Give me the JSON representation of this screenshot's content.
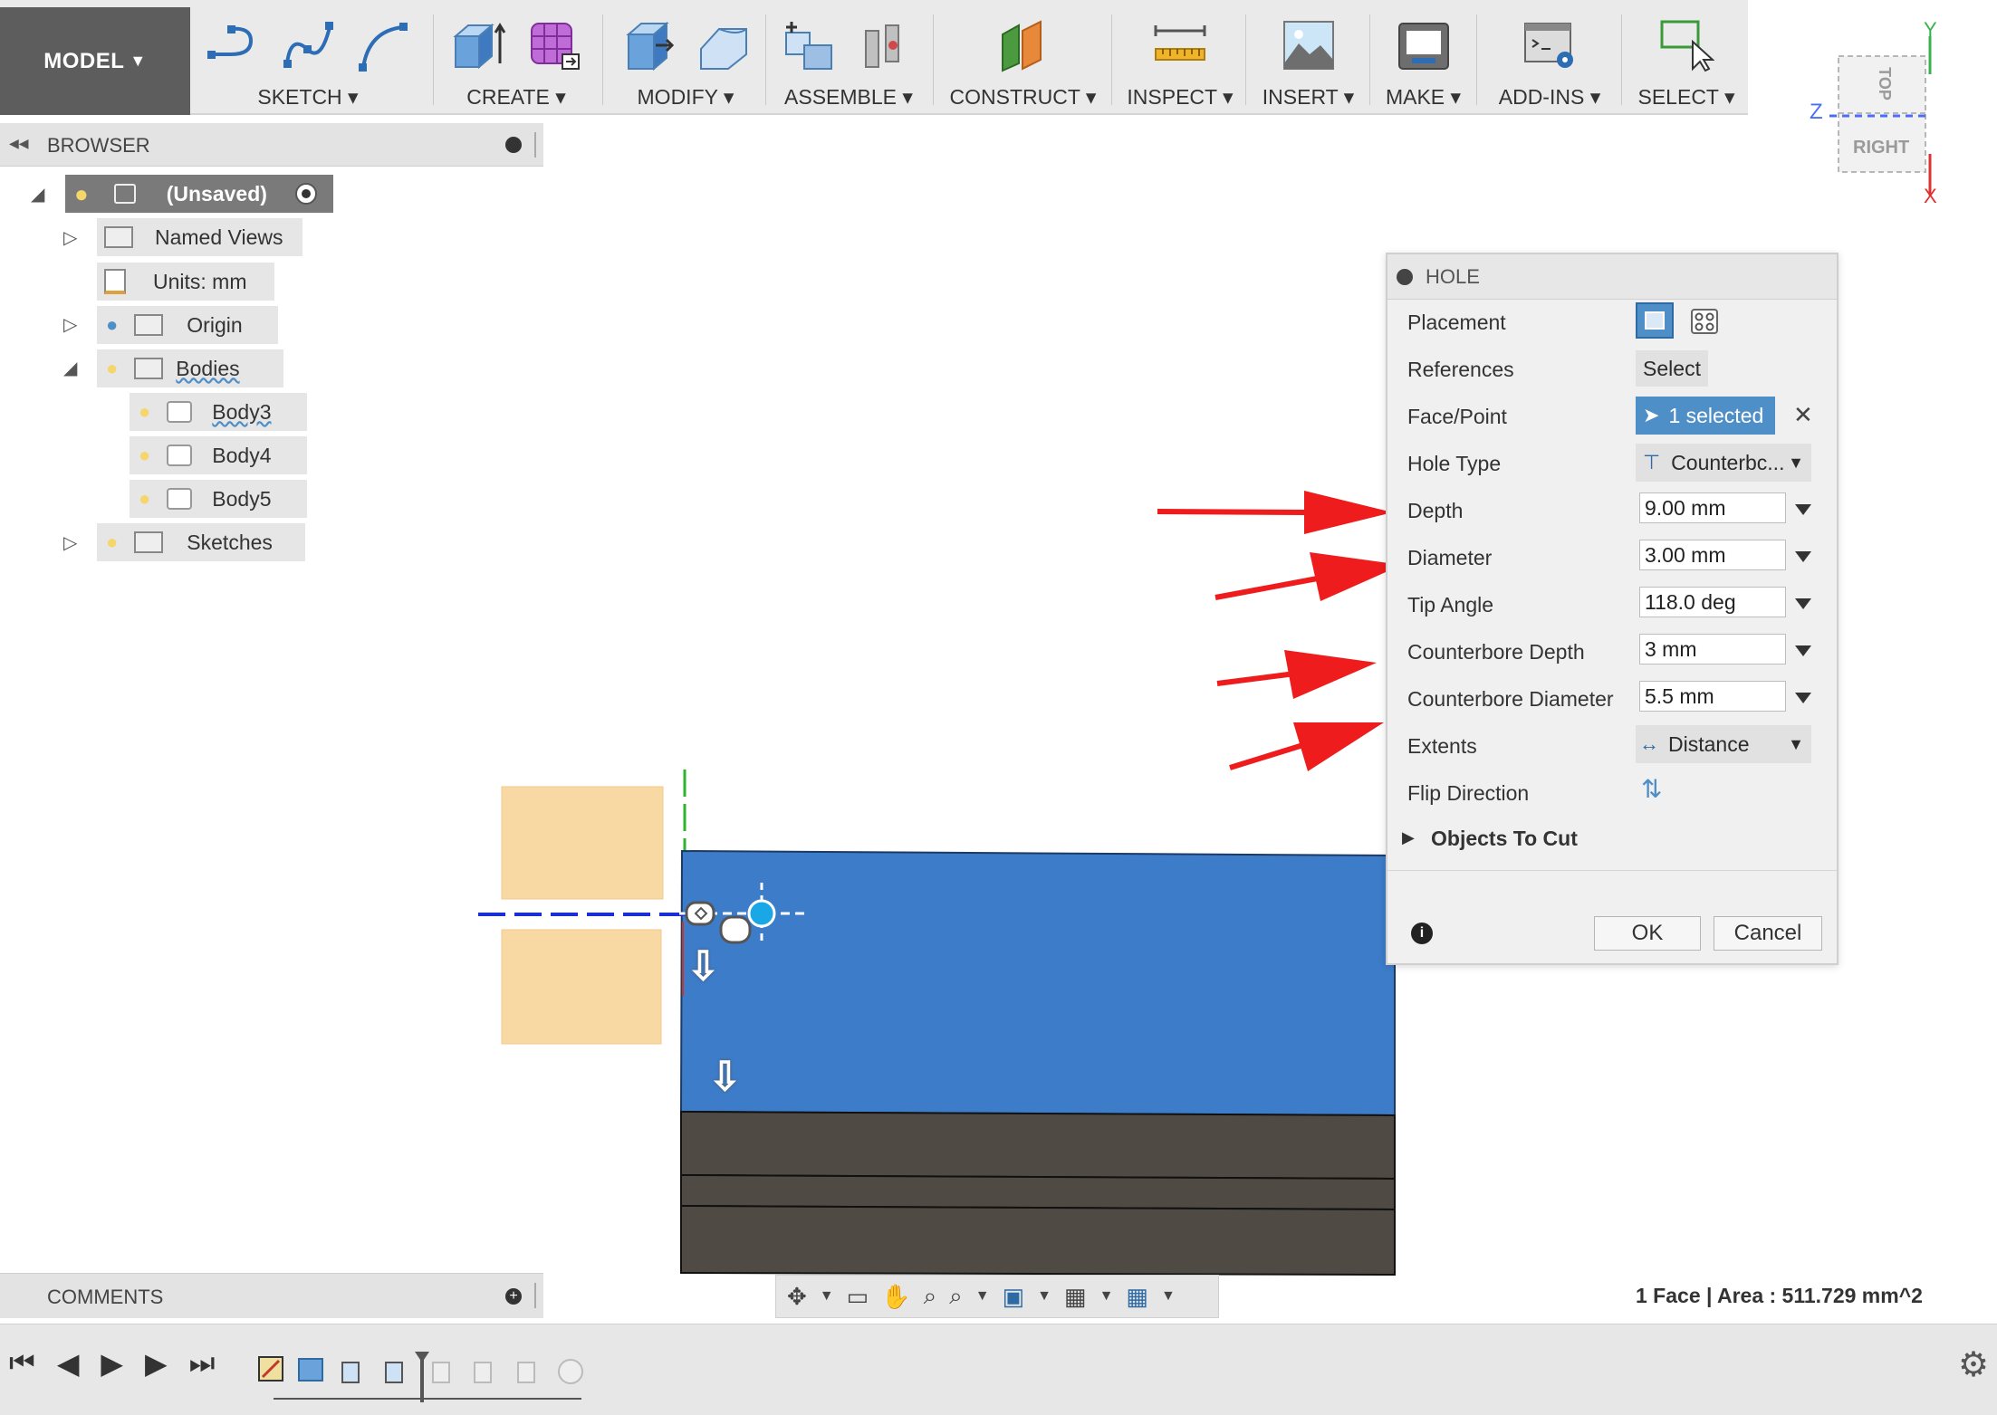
{
  "toolbar": {
    "model_label": "MODEL",
    "groups": [
      "SKETCH",
      "CREATE",
      "MODIFY",
      "ASSEMBLE",
      "CONSTRUCT",
      "INSPECT",
      "INSERT",
      "MAKE",
      "ADD-INS",
      "SELECT"
    ]
  },
  "viewcube": {
    "face": "RIGHT",
    "top": "TOP",
    "axis_y": "Y",
    "axis_z": "Z",
    "axis_x": "X"
  },
  "browser": {
    "title": "BROWSER",
    "root": "(Unsaved)",
    "items": {
      "named_views": "Named Views",
      "units": "Units: mm",
      "origin": "Origin",
      "bodies": "Bodies",
      "body3": "Body3",
      "body4": "Body4",
      "body5": "Body5",
      "sketches": "Sketches"
    }
  },
  "hole_panel": {
    "title": "HOLE",
    "placement_label": "Placement",
    "references_label": "References",
    "references_button": "Select",
    "face_point_label": "Face/Point",
    "face_point_value": "1 selected",
    "hole_type_label": "Hole Type",
    "hole_type_value": "Counterbc...",
    "depth_label": "Depth",
    "depth_value": "9.00 mm",
    "diameter_label": "Diameter",
    "diameter_value": "3.00 mm",
    "tip_angle_label": "Tip Angle",
    "tip_angle_value": "118.0 deg",
    "cb_depth_label": "Counterbore Depth",
    "cb_depth_value": "3 mm",
    "cb_diameter_label": "Counterbore Diameter",
    "cb_diameter_value": "5.5 mm",
    "extents_label": "Extents",
    "extents_value": "Distance",
    "flip_label": "Flip Direction",
    "objects_label": "Objects To Cut",
    "ok": "OK",
    "cancel": "Cancel"
  },
  "comments": {
    "title": "COMMENTS"
  },
  "status": {
    "selection": "1 Face | Area : 511.729 mm^2"
  },
  "colors": {
    "body_face": "#3d7cc9",
    "body_dark": "#4f4a44",
    "sketch_fill": "#f8d9a4",
    "annotation_arrow": "#ee1c1c",
    "selected": "#4f8fc8"
  }
}
